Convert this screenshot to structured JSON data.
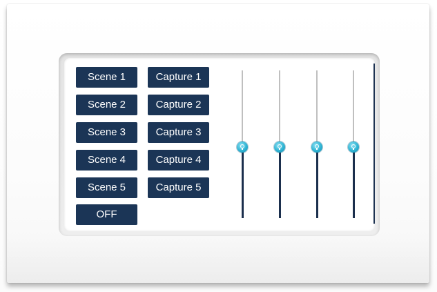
{
  "panel": {
    "scene_buttons": [
      {
        "label": "Scene 1"
      },
      {
        "label": "Scene 2"
      },
      {
        "label": "Scene 3"
      },
      {
        "label": "Scene 4"
      },
      {
        "label": "Scene 5"
      }
    ],
    "capture_buttons": [
      {
        "label": "Capture 1"
      },
      {
        "label": "Capture 2"
      },
      {
        "label": "Capture 3"
      },
      {
        "label": "Capture 4"
      },
      {
        "label": "Capture 5"
      }
    ],
    "off_button": {
      "label": "OFF"
    },
    "faders": [
      {
        "level_percent": 48
      },
      {
        "level_percent": 48
      },
      {
        "level_percent": 48
      },
      {
        "level_percent": 48
      }
    ]
  },
  "colors": {
    "button_bg": "#1b3556",
    "button_text": "#ffffff",
    "fader_thumb": "#2eb3d3",
    "fader_fill": "#1b2f4d",
    "fader_track": "#bfbfbf"
  },
  "icons": {
    "fader_thumb": "bulb-icon"
  }
}
